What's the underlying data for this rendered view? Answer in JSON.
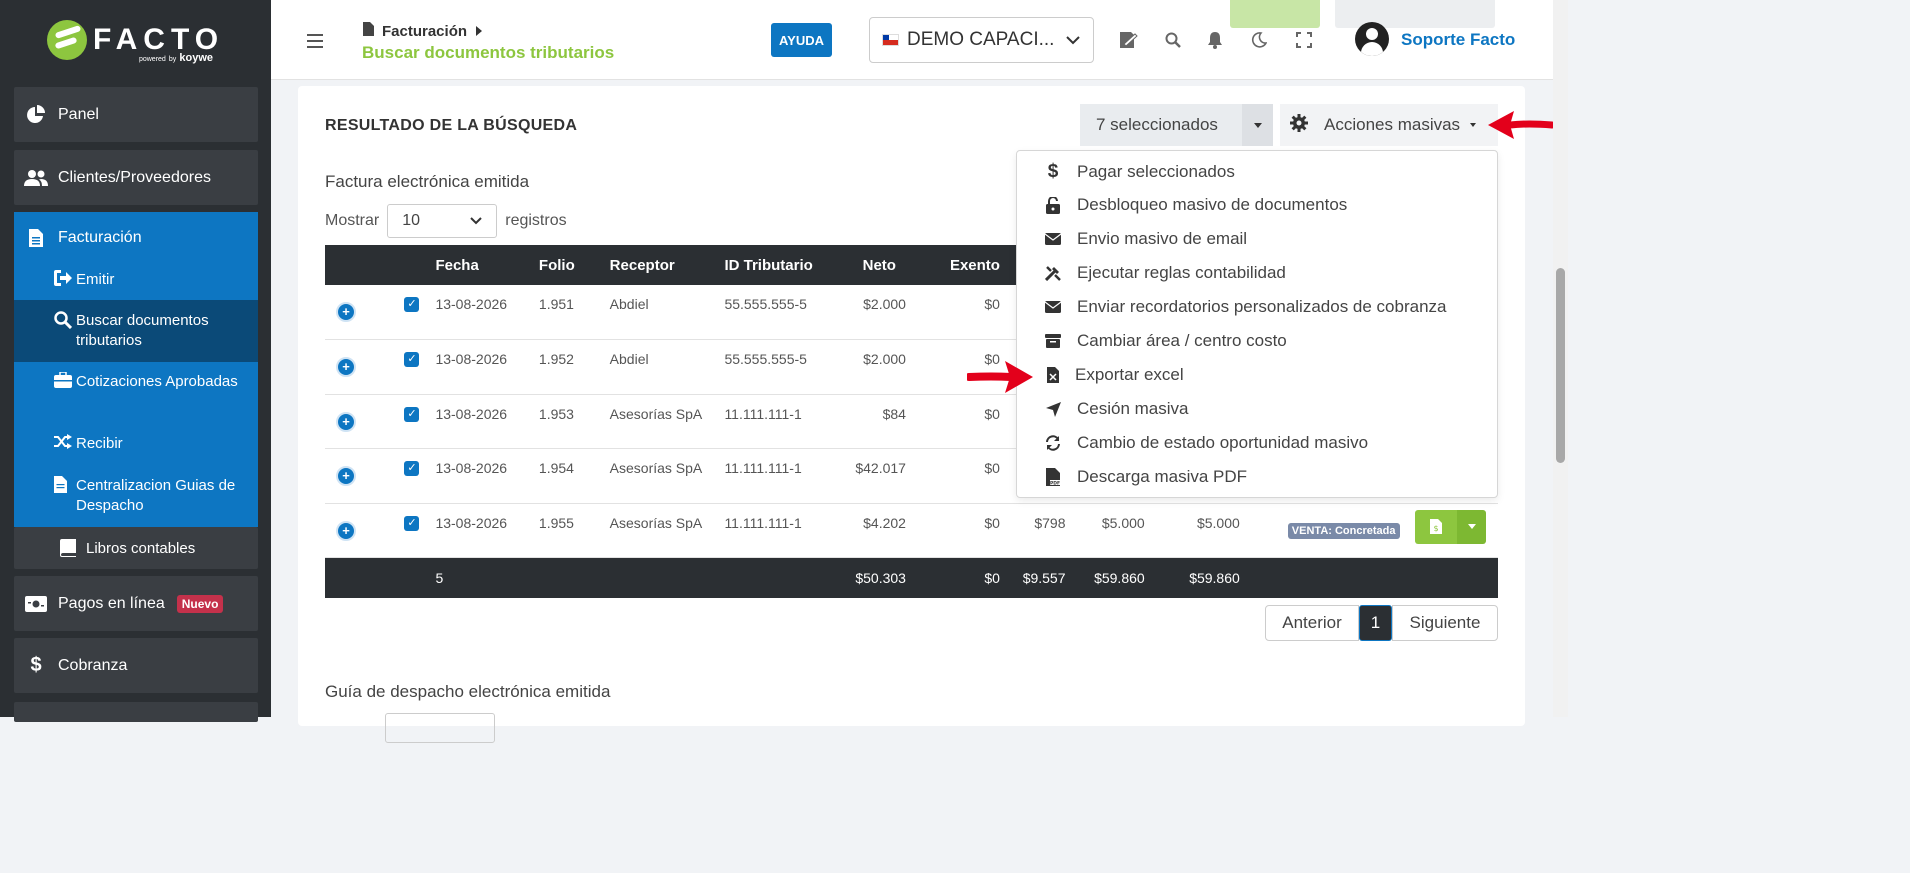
{
  "brand": {
    "name": "FACTO",
    "powered": "powered",
    "by": "by",
    "vendor": "koywe"
  },
  "sidebar": {
    "panel": "Panel",
    "clients": "Clientes/Proveedores",
    "billing": "Facturación",
    "billing_items": [
      "Emitir",
      "Buscar documentos tributarios",
      "Cotizaciones Aprobadas",
      "Recibir",
      "Centralizacion Guias de Despacho"
    ],
    "books": "Libros contables",
    "online_payments": "Pagos en línea",
    "online_badge": "Nuevo",
    "collections": "Cobranza"
  },
  "topbar": {
    "breadcrumb": "Facturación",
    "page_title": "Buscar documentos tributarios",
    "help": "AYUDA",
    "company": "DEMO CAPACI...",
    "user": "Soporte Facto"
  },
  "results": {
    "title": "RESULTADO DE LA BÚSQUEDA",
    "selected": "7 seleccionados",
    "mass_actions": "Acciones masivas",
    "subtitle": "Factura electrónica emitida",
    "show": "Mostrar",
    "page_length": "10",
    "records": "registros",
    "columns": [
      "Fecha",
      "Folio",
      "Receptor",
      "ID Tributario",
      "Neto",
      "Exento"
    ],
    "rows": [
      {
        "fecha": "13-08-2026",
        "folio": "1.951",
        "receptor": "Abdiel",
        "id": "55.555.555-5",
        "neto": "$2.000",
        "exento": "$0"
      },
      {
        "fecha": "13-08-2026",
        "folio": "1.952",
        "receptor": "Abdiel",
        "id": "55.555.555-5",
        "neto": "$2.000",
        "exento": "$0"
      },
      {
        "fecha": "13-08-2026",
        "folio": "1.953",
        "receptor": "Asesorías SpA",
        "id": "11.111.111-1",
        "neto": "$84",
        "exento": "$0"
      },
      {
        "fecha": "13-08-2026",
        "folio": "1.954",
        "receptor": "Asesorías SpA",
        "id": "11.111.111-1",
        "neto": "$42.017",
        "exento": "$0"
      },
      {
        "fecha": "13-08-2026",
        "folio": "1.955",
        "receptor": "Asesorías SpA",
        "id": "11.111.111-1",
        "neto": "$4.202",
        "exento": "$0",
        "iva": "$798",
        "total": "$5.000",
        "saldo": "$5.000",
        "estado": "VENTA: Concretada"
      }
    ],
    "totals": {
      "count": "5",
      "neto": "$50.303",
      "exento": "$0",
      "iva": "$9.557",
      "total": "$59.860",
      "saldo": "$59.860"
    },
    "prev": "Anterior",
    "page": "1",
    "next": "Siguiente",
    "section2": "Guía de despacho electrónica emitida"
  },
  "menu": {
    "items": [
      {
        "label": "Pagar seleccionados",
        "icon": "dollar-icon"
      },
      {
        "label": "Desbloqueo masivo de documentos",
        "icon": "unlock-icon"
      },
      {
        "label": "Envio masivo de email",
        "icon": "envelope-icon"
      },
      {
        "label": "Ejecutar reglas contabilidad",
        "icon": "tools-icon"
      },
      {
        "label": "Enviar recordatorios personalizados de cobranza",
        "icon": "envelope-icon"
      },
      {
        "label": "Cambiar área / centro costo",
        "icon": "archive-icon"
      },
      {
        "label": "Exportar excel",
        "icon": "excel-file-icon"
      },
      {
        "label": "Cesión masiva",
        "icon": "location-arrow-icon"
      },
      {
        "label": "Cambio de estado oportunidad masivo",
        "icon": "sync-icon"
      },
      {
        "label": "Descarga masiva PDF",
        "icon": "pdf-file-icon"
      }
    ]
  },
  "colors": {
    "accent": "#0d76c2",
    "green": "#8dc63f",
    "dark": "#2b2f33",
    "arrow": "#e3001b"
  }
}
